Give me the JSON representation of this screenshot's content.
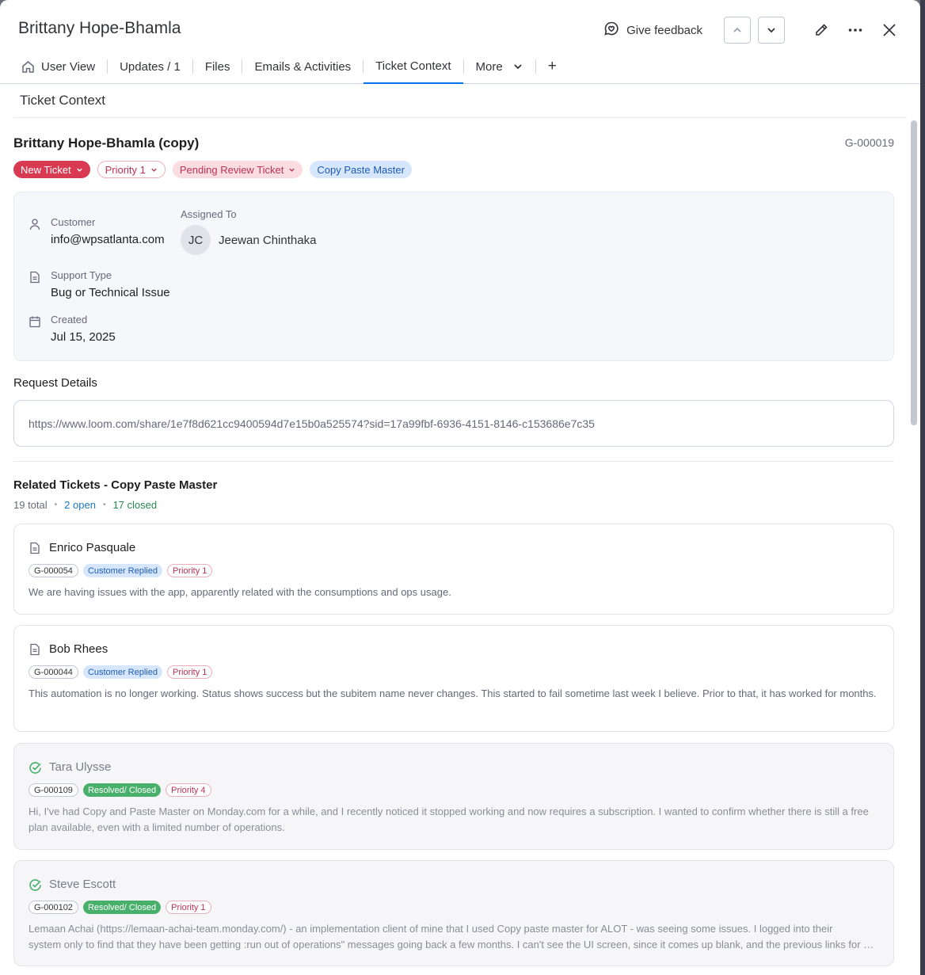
{
  "header": {
    "title": "Brittany Hope-Bhamla",
    "feedback_label": "Give feedback"
  },
  "tabs": [
    {
      "label": "User View"
    },
    {
      "label": "Updates / 1"
    },
    {
      "label": "Files"
    },
    {
      "label": "Emails & Activities"
    },
    {
      "label": "Ticket Context"
    },
    {
      "label": "More"
    },
    {
      "label": "+"
    }
  ],
  "section_title": "Ticket Context",
  "ticket": {
    "name": "Brittany Hope-Bhamla (copy)",
    "id": "G-000019",
    "status": "New Ticket",
    "priority": "Priority 1",
    "stage": "Pending Review Ticket",
    "product": "Copy Paste Master"
  },
  "info": {
    "customer_label": "Customer",
    "customer_value": "info@wpsatlanta.com",
    "assigned_label": "Assigned To",
    "assignee_initials": "JC",
    "assignee_name": "Jeewan Chinthaka",
    "support_label": "Support Type",
    "support_value": "Bug or Technical Issue",
    "created_label": "Created",
    "created_value": "Jul 15, 2025"
  },
  "request": {
    "label": "Request Details",
    "value": "https://www.loom.com/share/1e7f8d621cc9400594d7e15b0a525574?sid=17a99fbf-6936-4151-8146-c153686e7c35"
  },
  "related": {
    "title": "Related Tickets - Copy Paste Master",
    "total": "19 total",
    "open": "2 open",
    "closed": "17 closed",
    "tickets": [
      {
        "name": "Enrico Pasquale",
        "id": "G-000054",
        "status": "Customer Replied",
        "priority": "Priority 1",
        "desc": "We are having issues with the app, apparently related with the consumptions and ops usage."
      },
      {
        "name": "Bob Rhees",
        "id": "G-000044",
        "status": "Customer Replied",
        "priority": "Priority 1",
        "desc": "This automation is no longer working. Status shows success but the subitem name never changes. This started to fail sometime last week I believe. Prior to that, it has worked for months."
      },
      {
        "name": "Tara Ulysse",
        "id": "G-000109",
        "status": "Resolved/ Closed",
        "priority": "Priority 4",
        "desc": "Hi, I've had Copy and Paste Master on Monday.com for a while, and I recently noticed it stopped working and now requires a subscription. I wanted to confirm whether there is still a free plan available, even with a limited number of operations."
      },
      {
        "name": "Steve Escott",
        "id": "G-000102",
        "status": "Resolved/ Closed",
        "priority": "Priority 1",
        "desc_line1": "Lemaan Achai (https://lemaan-achai-team.monday.com/) - an implementation client of mine that I used Copy paste master for ALOT - was seeing some issues. I logged into their",
        "desc_line2": "system only to find that they have been getting :run out of operations\" messages going back a few months. I can't see the UI screen, since it comes up blank, and the previous links for different screens are also blank."
      }
    ]
  },
  "colors": {
    "accent": "#0073ea",
    "new_ticket": "#d83a52",
    "resolved": "#49b06c",
    "customer_replied_bg": "#d6e6fc"
  },
  "icons": [
    "feedback-icon",
    "chevron-up-icon",
    "chevron-down-icon",
    "pencil-icon",
    "more-dots-icon",
    "close-icon",
    "home-icon",
    "user-icon",
    "document-icon",
    "calendar-icon",
    "check-circle-icon"
  ]
}
